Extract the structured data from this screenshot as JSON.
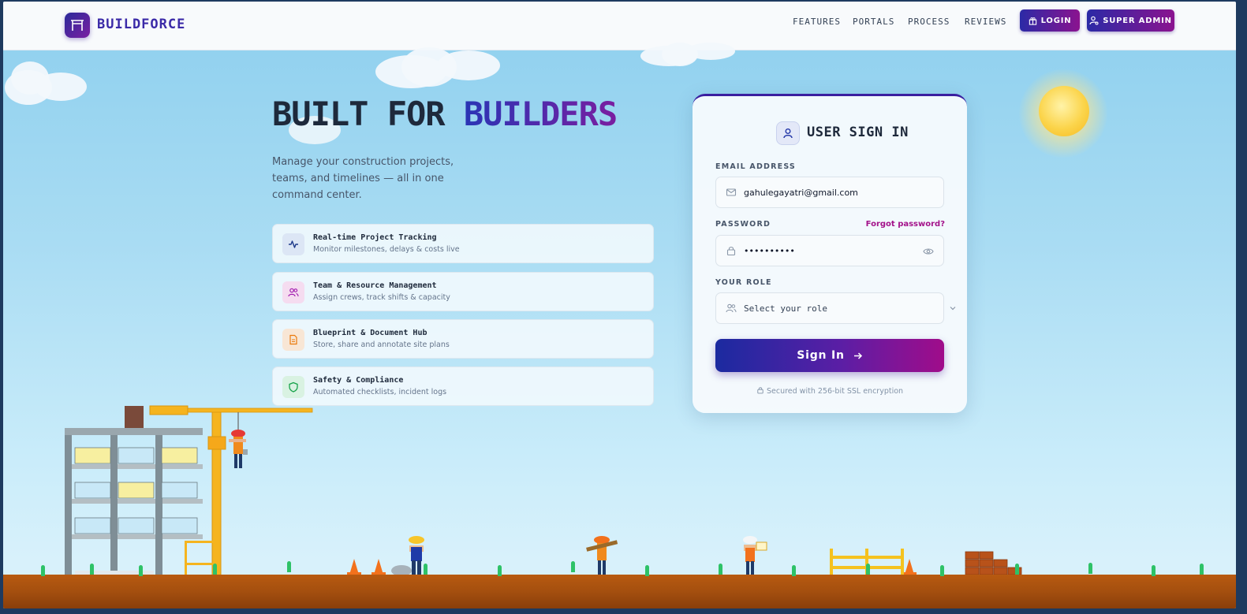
{
  "nav": {
    "brand": "BUILDFORCE",
    "links": [
      "FEATURES",
      "PORTALS",
      "PROCESS",
      "REVIEWS"
    ],
    "login_label": "LOGIN",
    "super_admin_label": "SUPER ADMIN"
  },
  "hero": {
    "title_plain": "BUILT FOR ",
    "title_accent": "BUILDERS",
    "subtitle": "Manage your construction projects, teams, and timelines — all in one command center."
  },
  "features": [
    {
      "title": "Real-time Project Tracking",
      "desc": "Monitor milestones, delays & costs live",
      "icon": "activity-icon",
      "color": "#1e3a8a"
    },
    {
      "title": "Team & Resource Management",
      "desc": "Assign crews, track shifts & capacity",
      "icon": "users-icon",
      "color": "#a21caf"
    },
    {
      "title": "Blueprint & Document Hub",
      "desc": "Store, share and annotate site plans",
      "icon": "document-icon",
      "color": "#ea7a0c"
    },
    {
      "title": "Safety & Compliance",
      "desc": "Automated checklists, incident logs",
      "icon": "shield-icon",
      "color": "#16a34a"
    }
  ],
  "login": {
    "title": "USER SIGN IN",
    "email_label": "EMAIL ADDRESS",
    "email_value": "gahulegayatri@gmail.com",
    "password_label": "PASSWORD",
    "forgot_label": "Forgot password?",
    "password_value": "••••••••••",
    "role_label": "YOUR ROLE",
    "role_placeholder": "Select your role",
    "submit_label": "Sign In",
    "secure_note": "Secured with 256-bit SSL encryption"
  },
  "colors": {
    "brand_start": "#2b2aa6",
    "brand_end": "#8b138f",
    "sky": "#a9dcf3",
    "ground": "#a44f0f"
  }
}
